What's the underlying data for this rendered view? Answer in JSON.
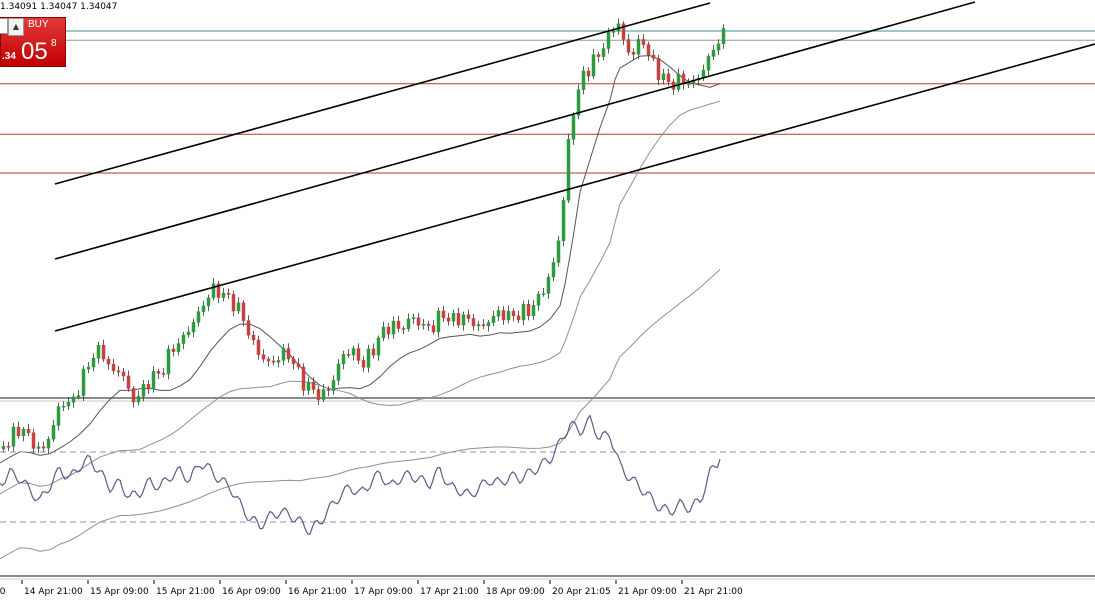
{
  "header": {
    "ohlc_text": "1.34091 1.34047 1.34047"
  },
  "trade_panel": {
    "buy_label": "BUY",
    "price_small": ".34",
    "price_big": "05",
    "price_super": "8"
  },
  "colors": {
    "bull_candle": "#2e9a3e",
    "bear_candle": "#c84040",
    "channel": "#000000",
    "resistance": "#b03a2e",
    "level_teal": "#3e8f9a",
    "level_gray": "#9a9a9a",
    "ma_fast": "#555555",
    "ma_slow": "#8f8f99",
    "oscillator": "#5b5b8a",
    "osc_level": "#9a8fb0"
  },
  "chart_data": {
    "type": "candlestick",
    "x_ticks": [
      "14 Apr 21:00",
      "15 Apr 09:00",
      "15 Apr 21:00",
      "16 Apr 09:00",
      "16 Apr 21:00",
      "17 Apr 09:00",
      "17 Apr 21:00",
      "18 Apr 09:00",
      "20 Apr 21:05",
      "21 Apr 09:00",
      "21 Apr 21:00"
    ],
    "close_series": [
      [
        0,
        1.289
      ],
      [
        10,
        1.292
      ],
      [
        20,
        1.2945
      ],
      [
        30,
        1.291
      ],
      [
        40,
        1.288
      ],
      [
        50,
        1.2935
      ],
      [
        60,
        1.301
      ],
      [
        70,
        1.3
      ],
      [
        80,
        1.306
      ],
      [
        90,
        1.312
      ],
      [
        100,
        1.314
      ],
      [
        110,
        1.308
      ],
      [
        120,
        1.309
      ],
      [
        130,
        1.301
      ],
      [
        140,
        1.303
      ],
      [
        150,
        1.307
      ],
      [
        160,
        1.308
      ],
      [
        170,
        1.314
      ],
      [
        180,
        1.316
      ],
      [
        190,
        1.32
      ],
      [
        200,
        1.324
      ],
      [
        210,
        1.329
      ],
      [
        220,
        1.328
      ],
      [
        230,
        1.326
      ],
      [
        240,
        1.323
      ],
      [
        250,
        1.316
      ],
      [
        260,
        1.312
      ],
      [
        270,
        1.31
      ],
      [
        280,
        1.313
      ],
      [
        290,
        1.312
      ],
      [
        300,
        1.306
      ],
      [
        310,
        1.304
      ],
      [
        320,
        1.302
      ],
      [
        330,
        1.305
      ],
      [
        340,
        1.312
      ],
      [
        350,
        1.314
      ],
      [
        360,
        1.31
      ],
      [
        370,
        1.313
      ],
      [
        380,
        1.318
      ],
      [
        390,
        1.32
      ],
      [
        400,
        1.319
      ],
      [
        410,
        1.322
      ],
      [
        420,
        1.32
      ],
      [
        430,
        1.319
      ],
      [
        440,
        1.323
      ],
      [
        450,
        1.321
      ],
      [
        460,
        1.322
      ],
      [
        470,
        1.321
      ],
      [
        480,
        1.319
      ],
      [
        490,
        1.322
      ],
      [
        500,
        1.323
      ],
      [
        510,
        1.322
      ],
      [
        520,
        1.323
      ],
      [
        530,
        1.324
      ],
      [
        540,
        1.328
      ],
      [
        550,
        1.333
      ],
      [
        560,
        1.345
      ],
      [
        565,
        1.361
      ],
      [
        570,
        1.372
      ],
      [
        575,
        1.376
      ],
      [
        580,
        1.382
      ],
      [
        590,
        1.385
      ],
      [
        600,
        1.389
      ],
      [
        610,
        1.393
      ],
      [
        615,
        1.397
      ],
      [
        620,
        1.392
      ],
      [
        630,
        1.387
      ],
      [
        640,
        1.392
      ],
      [
        650,
        1.386
      ],
      [
        660,
        1.382
      ],
      [
        670,
        1.38
      ],
      [
        680,
        1.3815
      ],
      [
        690,
        1.38
      ],
      [
        700,
        1.383
      ],
      [
        710,
        1.388
      ],
      [
        720,
        1.3925
      ]
    ],
    "overlays": {
      "channel_lines": [
        [
          [
            55,
            184
          ],
          [
            710,
            3
          ]
        ],
        [
          [
            55,
            259
          ],
          [
            975,
            2
          ]
        ],
        [
          [
            55,
            331
          ],
          [
            1095,
            44
          ]
        ]
      ],
      "horizontal_levels": [
        {
          "price": 1.3935,
          "style": "teal"
        },
        {
          "price": 1.3912,
          "style": "gray"
        },
        {
          "price": 1.3803,
          "style": "red"
        },
        {
          "price": 1.3677,
          "style": "red"
        },
        {
          "price": 1.358,
          "style": "red"
        }
      ]
    },
    "oscillator": {
      "levels": [
        70,
        30
      ],
      "values": [
        [
          0,
          52
        ],
        [
          10,
          58
        ],
        [
          20,
          55
        ],
        [
          30,
          48
        ],
        [
          40,
          42
        ],
        [
          50,
          51
        ],
        [
          60,
          60
        ],
        [
          70,
          55
        ],
        [
          80,
          62
        ],
        [
          90,
          66
        ],
        [
          100,
          58
        ],
        [
          110,
          50
        ],
        [
          120,
          52
        ],
        [
          130,
          44
        ],
        [
          140,
          47
        ],
        [
          150,
          53
        ],
        [
          160,
          50
        ],
        [
          170,
          56
        ],
        [
          180,
          59
        ],
        [
          190,
          54
        ],
        [
          200,
          64
        ],
        [
          210,
          60
        ],
        [
          220,
          54
        ],
        [
          230,
          50
        ],
        [
          240,
          40
        ],
        [
          250,
          32
        ],
        [
          260,
          28
        ],
        [
          270,
          33
        ],
        [
          280,
          36
        ],
        [
          290,
          34
        ],
        [
          300,
          30
        ],
        [
          310,
          25
        ],
        [
          320,
          30
        ],
        [
          330,
          38
        ],
        [
          340,
          45
        ],
        [
          350,
          50
        ],
        [
          360,
          46
        ],
        [
          370,
          52
        ],
        [
          380,
          58
        ],
        [
          390,
          50
        ],
        [
          400,
          55
        ],
        [
          410,
          57
        ],
        [
          420,
          54
        ],
        [
          430,
          52
        ],
        [
          440,
          60
        ],
        [
          450,
          50
        ],
        [
          460,
          48
        ],
        [
          470,
          45
        ],
        [
          480,
          50
        ],
        [
          490,
          54
        ],
        [
          500,
          52
        ],
        [
          510,
          56
        ],
        [
          520,
          55
        ],
        [
          530,
          58
        ],
        [
          540,
          62
        ],
        [
          550,
          66
        ],
        [
          560,
          75
        ],
        [
          570,
          86
        ],
        [
          580,
          82
        ],
        [
          590,
          88
        ],
        [
          600,
          78
        ],
        [
          610,
          80
        ],
        [
          620,
          62
        ],
        [
          630,
          55
        ],
        [
          640,
          50
        ],
        [
          650,
          44
        ],
        [
          660,
          38
        ],
        [
          670,
          36
        ],
        [
          680,
          40
        ],
        [
          690,
          38
        ],
        [
          700,
          42
        ],
        [
          710,
          58
        ],
        [
          720,
          66
        ]
      ]
    }
  }
}
